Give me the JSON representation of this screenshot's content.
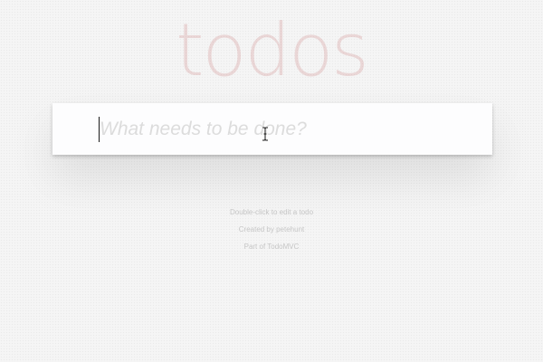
{
  "header": {
    "title": "todos"
  },
  "new_todo": {
    "placeholder": "What needs to be done?",
    "value": ""
  },
  "footer_info": {
    "hint": "Double-click to edit a todo",
    "credit": "Created by petehunt",
    "part_of": "Part of TodoMVC"
  },
  "icons": {
    "cursor": "text-ibeam-cursor-icon"
  },
  "colors": {
    "title": "#af2f2f",
    "background": "#f5f5f5",
    "input_background": "#fdfdfe",
    "placeholder": "#dcdcdc",
    "info_text": "#c6c6c6"
  }
}
